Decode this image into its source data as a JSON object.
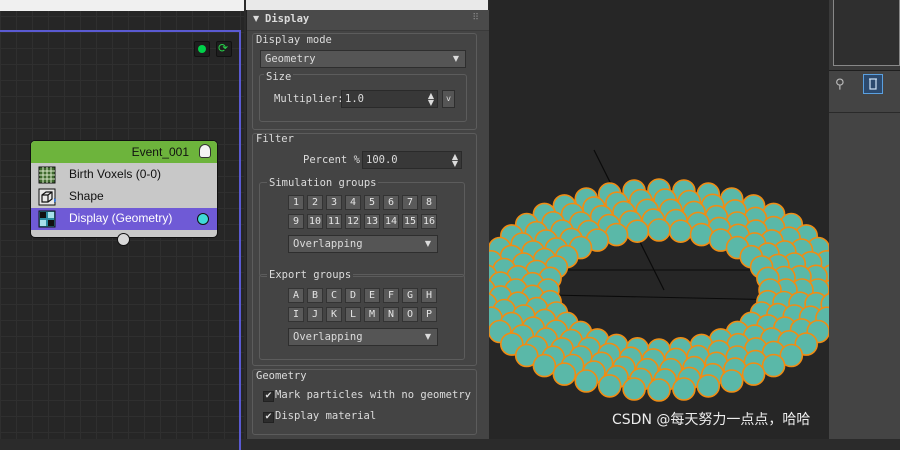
{
  "node_editor": {
    "event_title": "Event_001",
    "operators": [
      {
        "label": "Birth Voxels (0-0)",
        "icon": "grid-icon"
      },
      {
        "label": "Shape",
        "icon": "cube-icon"
      },
      {
        "label": "Display (Geometry)",
        "icon": "display-icon"
      }
    ]
  },
  "display_panel": {
    "header": "Display",
    "display_mode_label": "Display mode",
    "display_mode_value": "Geometry",
    "size_label": "Size",
    "multiplier_label": "Multiplier:",
    "multiplier_value": "1.0",
    "filter_label": "Filter",
    "percent_label": "Percent %:",
    "percent_value": "100.0",
    "simulation_groups_label": "Simulation groups",
    "simulation_groups": [
      "1",
      "2",
      "3",
      "4",
      "5",
      "6",
      "7",
      "8",
      "9",
      "10",
      "11",
      "12",
      "13",
      "14",
      "15",
      "16"
    ],
    "simulation_overlap": "Overlapping",
    "export_groups_label": "Export groups",
    "export_groups": [
      "A",
      "B",
      "C",
      "D",
      "E",
      "F",
      "G",
      "H",
      "I",
      "J",
      "K",
      "L",
      "M",
      "N",
      "O",
      "P"
    ],
    "export_overlap": "Overlapping",
    "geometry_label": "Geometry",
    "mark_particles_label": "Mark particles with no geometry",
    "display_material_label": "Display material"
  },
  "watermark": "CSDN @每天努力一点点，哈哈",
  "colors": {
    "event_header": "#6db43c",
    "selected_operator": "#6f5ad6",
    "particle": "#5ab8a8",
    "particle_wire": "#f08c14"
  }
}
